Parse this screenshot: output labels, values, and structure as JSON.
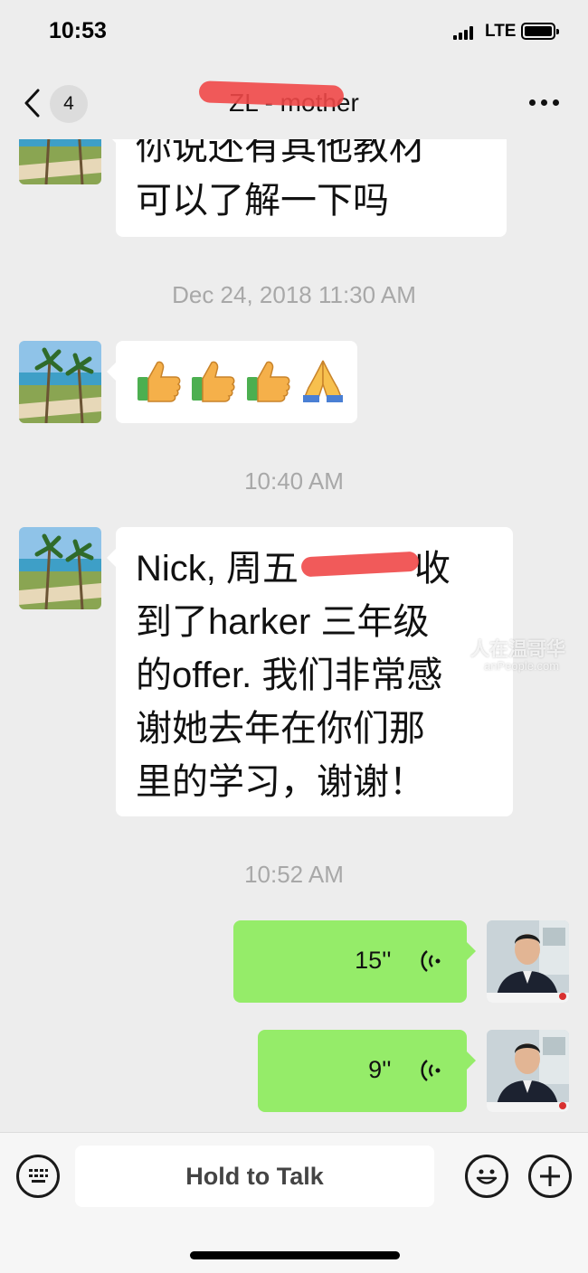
{
  "status_bar": {
    "time": "10:53",
    "network": "LTE"
  },
  "nav": {
    "back_badge": "4",
    "title": "ZL - mother"
  },
  "messages": [
    {
      "type": "text",
      "side": "incoming",
      "lines": [
        "你说还有其他教材",
        "可以了解一下吗"
      ]
    },
    {
      "type": "timestamp",
      "text": "Dec 24, 2018 11:30 AM"
    },
    {
      "type": "emoji",
      "side": "incoming",
      "emojis": [
        "thumbs-up",
        "thumbs-up",
        "thumbs-up",
        "folded-hands"
      ]
    },
    {
      "type": "timestamp",
      "text": "10:40 AM"
    },
    {
      "type": "text",
      "side": "incoming",
      "lines": [
        "Nick, 周五",
        "到了harker 三年级",
        "的offer. 我们非常感",
        "谢她去年在你们那",
        "里的学习，谢谢！"
      ],
      "line1_suffix": "收"
    },
    {
      "type": "timestamp",
      "text": "10:52 AM"
    },
    {
      "type": "voice",
      "side": "outgoing",
      "duration": "15''"
    },
    {
      "type": "voice",
      "side": "outgoing",
      "duration": "9''"
    }
  ],
  "watermark": {
    "text": "人在温哥华",
    "sub": "anPeople.com"
  },
  "input_bar": {
    "hold_label": "Hold to Talk",
    "left_icon": "keyboard-icon",
    "emoji_icon": "smiley-icon",
    "plus_icon": "plus-icon"
  },
  "colors": {
    "background": "#ededed",
    "incoming_bubble": "#ffffff",
    "outgoing_bubble": "#95ec69",
    "timestamp": "#a8a8a8",
    "redaction": "#f04848"
  }
}
